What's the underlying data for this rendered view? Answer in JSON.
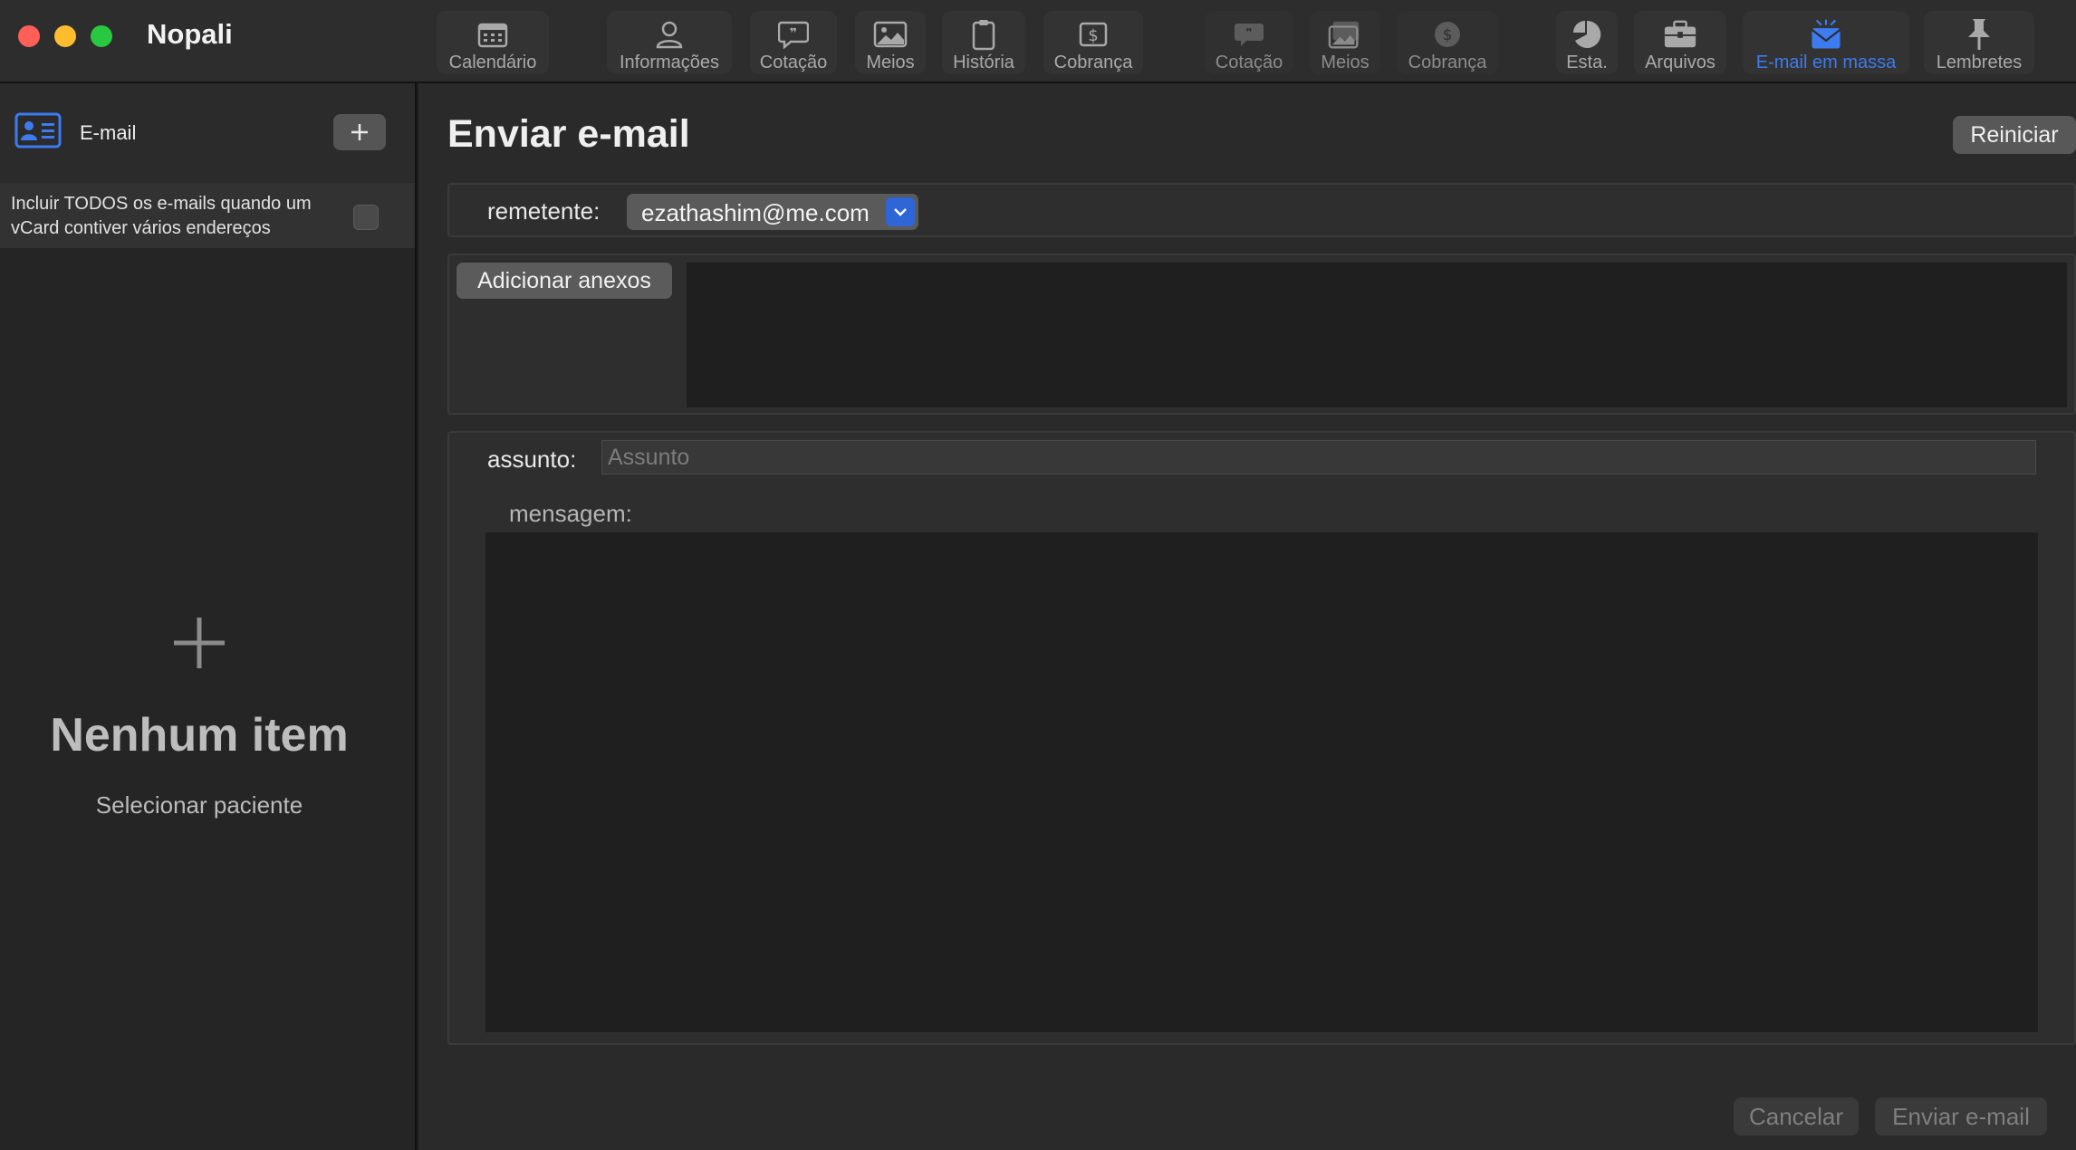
{
  "window": {
    "title": "Nopali"
  },
  "toolbar": {
    "items": [
      {
        "label": "Calendário",
        "icon": "calendar-icon"
      },
      {
        "label": "Informações",
        "icon": "person-icon"
      },
      {
        "label": "Cotação",
        "icon": "quote-icon"
      },
      {
        "label": "Meios",
        "icon": "media-icon"
      },
      {
        "label": "História",
        "icon": "clipboard-icon"
      },
      {
        "label": "Cobrança",
        "icon": "billing-icon"
      },
      {
        "label": "Cotação",
        "icon": "quote-icon",
        "state": "disabled"
      },
      {
        "label": "Meios",
        "icon": "media-icon",
        "state": "disabled"
      },
      {
        "label": "Cobrança",
        "icon": "billing-icon",
        "state": "disabled"
      },
      {
        "label": "Esta.",
        "icon": "pie-chart-icon"
      },
      {
        "label": "Arquivos",
        "icon": "briefcase-icon"
      },
      {
        "label": "E-mail em massa",
        "icon": "mass-email-icon",
        "state": "active"
      },
      {
        "label": "Lembretes",
        "icon": "pin-icon"
      }
    ]
  },
  "sidebar": {
    "header_label": "E-mail",
    "add_button": "+",
    "include_all_option": "Incluir TODOS os e-mails quando um vCard contiver vários endereços",
    "include_all_checked": false,
    "empty_state": {
      "title": "Nenhum item",
      "subtitle": "Selecionar paciente"
    }
  },
  "main": {
    "title": "Enviar e-mail",
    "reset_button": "Reiniciar",
    "sender_label": "remetente:",
    "sender_value": "ezathashim@me.com",
    "attach_button": "Adicionar anexos",
    "subject_label": "assunto:",
    "subject_placeholder": "Assunto",
    "subject_value": "",
    "message_label": "mensagem:",
    "message_value": "",
    "cancel_button": "Cancelar",
    "send_button": "Enviar e-mail"
  },
  "colors": {
    "accent": "#3d7bf0",
    "dropdown_accent": "#2e66d8",
    "traffic_close": "#ff5f57",
    "traffic_minimize": "#febc2e",
    "traffic_maximize": "#28c840"
  }
}
